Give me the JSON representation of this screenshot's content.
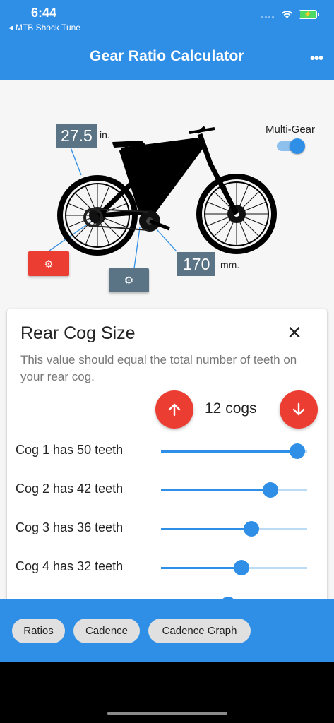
{
  "status": {
    "time": "6:44",
    "back_app": "MTB Shock Tune"
  },
  "appbar": {
    "title": "Gear Ratio Calculator",
    "more_icon": "more-horizontal-icon"
  },
  "bike": {
    "wheel_size": "27.5",
    "wheel_unit": "in.",
    "crank_length": "170",
    "crank_unit": "mm.",
    "multi_gear_label": "Multi-Gear",
    "multi_gear_on": true
  },
  "sheet": {
    "title": "Rear Cog Size",
    "description": "This value should equal the total number of teeth on your rear cog.",
    "cog_count": "12 cogs",
    "cogs": [
      {
        "label": "Cog 1 has 50 teeth",
        "fraction": 0.93
      },
      {
        "label": "Cog 2 has 42 teeth",
        "fraction": 0.75
      },
      {
        "label": "Cog 3 has 36 teeth",
        "fraction": 0.62
      },
      {
        "label": "Cog 4 has 32 teeth",
        "fraction": 0.55
      },
      {
        "label": "",
        "fraction": 0.46
      }
    ]
  },
  "bottom_bar": {
    "chips": [
      "Ratios",
      "Cadence",
      "Cadence Graph"
    ]
  },
  "colors": {
    "primary": "#2f8fe6",
    "accent": "#ec3d32",
    "slate": "#5a7485"
  }
}
